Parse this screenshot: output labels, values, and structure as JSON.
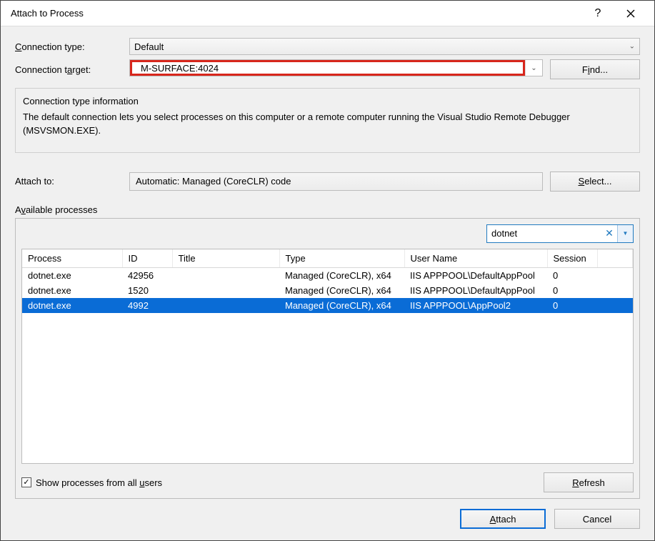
{
  "window": {
    "title": "Attach to Process",
    "help_tooltip": "?",
    "close_tooltip": "Close"
  },
  "fields": {
    "connection_type_label_pre": "C",
    "connection_type_label_mid": "onnection type:",
    "connection_type_value": "Default",
    "connection_target_label_pre": "Connection t",
    "connection_target_label_u": "a",
    "connection_target_label_post": "rget:",
    "connection_target_value": "M-SURFACE:4024",
    "find_label_pre": "F",
    "find_label_u": "i",
    "find_label_post": "nd...",
    "info_title": "Connection type information",
    "info_body": "The default connection lets you select processes on this computer or a remote computer running the Visual Studio Remote Debugger (MSVSMON.EXE).",
    "attach_to_label": "Attach to:",
    "attach_to_value": "Automatic: Managed (CoreCLR) code",
    "select_label_u": "S",
    "select_label_post": "elect...",
    "available_label_pre": "A",
    "available_label_u": "v",
    "available_label_post": "ailable processes",
    "filter_value": "dotnet",
    "refresh_label_u": "R",
    "refresh_label_post": "efresh",
    "show_all_users_pre": "Show processes from all ",
    "show_all_users_u": "u",
    "show_all_users_post": "sers",
    "show_all_users_checked": true
  },
  "columns": {
    "process": "Process",
    "id": "ID",
    "title": "Title",
    "type": "Type",
    "user": "User Name",
    "session": "Session"
  },
  "processes": [
    {
      "process": "dotnet.exe",
      "id": "42956",
      "title": "",
      "type": "Managed (CoreCLR), x64",
      "user": "IIS APPPOOL\\DefaultAppPool",
      "session": "0",
      "selected": false
    },
    {
      "process": "dotnet.exe",
      "id": "1520",
      "title": "",
      "type": "Managed (CoreCLR), x64",
      "user": "IIS APPPOOL\\DefaultAppPool",
      "session": "0",
      "selected": false
    },
    {
      "process": "dotnet.exe",
      "id": "4992",
      "title": "",
      "type": "Managed (CoreCLR), x64",
      "user": "IIS APPPOOL\\AppPool2",
      "session": "0",
      "selected": true
    }
  ],
  "footer": {
    "attach_u": "A",
    "attach_post": "ttach",
    "cancel": "Cancel"
  }
}
